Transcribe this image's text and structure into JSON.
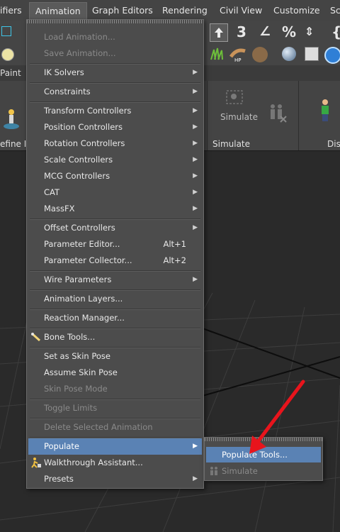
{
  "menubar": {
    "items": [
      "ifiers",
      "Animation",
      "Graph Editors",
      "Rendering",
      "Civil View",
      "Customize",
      "Sc"
    ]
  },
  "ribbon": {
    "tab_partial": "Paint",
    "define_partial": "efine Id",
    "simulate_button": "Simulate",
    "simulate_section": "Simulate",
    "display_partial": "Dis"
  },
  "animation_menu": {
    "items": [
      {
        "label": "Load Animation...",
        "enabled": false,
        "submenu": false
      },
      {
        "label": "Save Animation...",
        "enabled": false,
        "submenu": false
      },
      {
        "label": "IK Solvers",
        "enabled": true,
        "submenu": true
      },
      {
        "label": "Constraints",
        "enabled": true,
        "submenu": true
      },
      {
        "label": "Transform Controllers",
        "enabled": true,
        "submenu": true
      },
      {
        "label": "Position Controllers",
        "enabled": true,
        "submenu": true
      },
      {
        "label": "Rotation Controllers",
        "enabled": true,
        "submenu": true
      },
      {
        "label": "Scale Controllers",
        "enabled": true,
        "submenu": true
      },
      {
        "label": "MCG Controllers",
        "enabled": true,
        "submenu": true
      },
      {
        "label": "CAT",
        "enabled": true,
        "submenu": true
      },
      {
        "label": "MassFX",
        "enabled": true,
        "submenu": true
      },
      {
        "label": "Offset Controllers",
        "enabled": true,
        "submenu": true
      },
      {
        "label": "Parameter Editor...",
        "shortcut": "Alt+1",
        "enabled": true,
        "submenu": false
      },
      {
        "label": "Parameter Collector...",
        "shortcut": "Alt+2",
        "enabled": true,
        "submenu": false
      },
      {
        "label": "Wire Parameters",
        "enabled": true,
        "submenu": true
      },
      {
        "label": "Animation Layers...",
        "enabled": true,
        "submenu": false
      },
      {
        "label": "Reaction Manager...",
        "enabled": true,
        "submenu": false
      },
      {
        "label": "Bone Tools...",
        "enabled": true,
        "submenu": false,
        "icon": "bone-icon"
      },
      {
        "label": "Set as Skin Pose",
        "enabled": true,
        "submenu": false
      },
      {
        "label": "Assume Skin Pose",
        "enabled": true,
        "submenu": false
      },
      {
        "label": "Skin Pose Mode",
        "enabled": false,
        "submenu": false
      },
      {
        "label": "Toggle Limits",
        "enabled": false,
        "submenu": false
      },
      {
        "label": "Delete Selected Animation",
        "enabled": false,
        "submenu": false
      },
      {
        "label": "Populate",
        "enabled": true,
        "submenu": true,
        "selected": true
      },
      {
        "label": "Walkthrough Assistant...",
        "enabled": true,
        "submenu": false,
        "icon": "walkthrough-icon"
      },
      {
        "label": "Presets",
        "enabled": true,
        "submenu": true
      }
    ]
  },
  "populate_submenu": {
    "items": [
      {
        "label": "Populate Tools...",
        "enabled": true,
        "selected": true
      },
      {
        "label": "Simulate",
        "enabled": false,
        "icon": "simulate-icon"
      }
    ]
  },
  "colors": {
    "highlight": "#5a82b4",
    "annotation_arrow": "#e8141c",
    "menu_bg": "#4c4c4c"
  }
}
